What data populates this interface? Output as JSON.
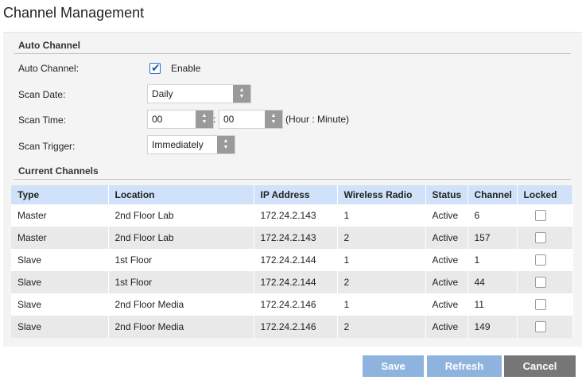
{
  "page": {
    "title": "Channel Management"
  },
  "auto_channel": {
    "section_title": "Auto Channel",
    "auto_channel_label": "Auto Channel:",
    "enable_label": "Enable",
    "enable_checked": true,
    "scan_date_label": "Scan Date:",
    "scan_date_value": "Daily",
    "scan_time_label": "Scan Time:",
    "scan_time_hour": "00",
    "scan_time_minute": "00",
    "scan_time_separator": ":",
    "scan_time_hint": "(Hour : Minute)",
    "scan_trigger_label": "Scan Trigger:",
    "scan_trigger_value": "Immediately"
  },
  "current_channels": {
    "section_title": "Current Channels",
    "columns": [
      "Type",
      "Location",
      "IP Address",
      "Wireless Radio",
      "Status",
      "Channel",
      "Locked"
    ],
    "rows": [
      {
        "type": "Master",
        "location": "2nd Floor Lab",
        "ip": "172.24.2.143",
        "radio": "1",
        "status": "Active",
        "channel": "6",
        "locked": false
      },
      {
        "type": "Master",
        "location": "2nd Floor Lab",
        "ip": "172.24.2.143",
        "radio": "2",
        "status": "Active",
        "channel": "157",
        "locked": false
      },
      {
        "type": "Slave",
        "location": "1st Floor",
        "ip": "172.24.2.144",
        "radio": "1",
        "status": "Active",
        "channel": "1",
        "locked": false
      },
      {
        "type": "Slave",
        "location": "1st Floor",
        "ip": "172.24.2.144",
        "radio": "2",
        "status": "Active",
        "channel": "44",
        "locked": false
      },
      {
        "type": "Slave",
        "location": "2nd Floor Media",
        "ip": "172.24.2.146",
        "radio": "1",
        "status": "Active",
        "channel": "11",
        "locked": false
      },
      {
        "type": "Slave",
        "location": "2nd Floor Media",
        "ip": "172.24.2.146",
        "radio": "2",
        "status": "Active",
        "channel": "149",
        "locked": false
      }
    ]
  },
  "buttons": {
    "save": "Save",
    "refresh": "Refresh",
    "cancel": "Cancel"
  },
  "colors": {
    "header_bg": "#cfe2fa",
    "primary_button": "#8fb3df",
    "cancel_button": "#777777",
    "checkbox_accent": "#1e5bb8"
  },
  "icons": {
    "enable_checkbox": "check-icon",
    "spinner": "up-down-arrows-icon"
  }
}
